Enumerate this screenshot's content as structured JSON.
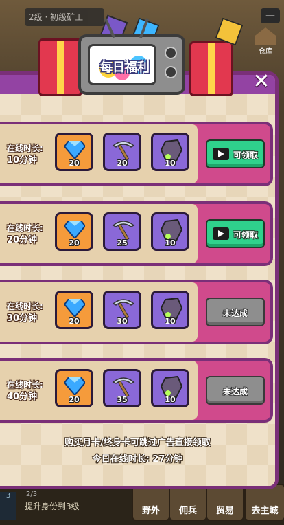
{
  "background": {
    "level_banner": "2级 · 初级矿工",
    "warehouse_label": "仓库",
    "quest_progress": "2/3",
    "quest_text": "提升身份到3级",
    "quest_count": "3",
    "nav": [
      "野外",
      "佣兵",
      "贸易",
      "去主城"
    ]
  },
  "popup": {
    "title": "每日福利",
    "close_symbol": "✕",
    "rows": [
      {
        "label_line1": "在线时长:",
        "label_line2": "10分钟",
        "gem_qty": "20",
        "pickaxe_qty": "20",
        "ore_qty": "10",
        "button": "可领取",
        "state": "claim"
      },
      {
        "label_line1": "在线时长:",
        "label_line2": "20分钟",
        "gem_qty": "20",
        "pickaxe_qty": "25",
        "ore_qty": "10",
        "button": "可领取",
        "state": "claim"
      },
      {
        "label_line1": "在线时长:",
        "label_line2": "30分钟",
        "gem_qty": "20",
        "pickaxe_qty": "30",
        "ore_qty": "10",
        "button": "未达成",
        "state": "locked"
      },
      {
        "label_line1": "在线时长:",
        "label_line2": "40分钟",
        "gem_qty": "20",
        "pickaxe_qty": "35",
        "ore_qty": "10",
        "button": "未达成",
        "state": "locked"
      }
    ],
    "footer_note": "购买月卡/终身卡可跳过广告直接领取",
    "footer_time": "今日在线时长: 27分钟"
  },
  "colors": {
    "accent_purple": "#9343a3",
    "row_pink": "#d04a8c",
    "claim_green": "#2fd18c",
    "locked_gray": "#8e8e8e",
    "slot_orange": "#f59b3b",
    "slot_purple": "#8a68d8"
  },
  "icons": [
    "video-icon",
    "diamond-icon",
    "pickaxe-icon",
    "ore-icon",
    "close-icon",
    "warehouse-icon"
  ]
}
